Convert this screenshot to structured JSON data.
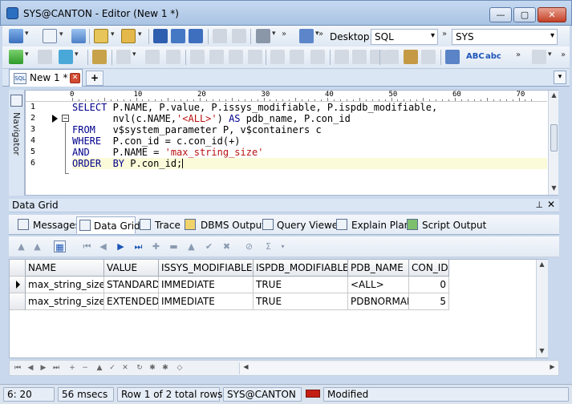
{
  "window": {
    "title": "SYS@CANTON - Editor (New 1 *)",
    "min_label": "—",
    "max_label": "▢",
    "close_label": "✕"
  },
  "toolbar": {
    "desktop_label": "Desktop:",
    "desktop_value": "SQL",
    "session_value": "SYS",
    "abc_upper": "ABC",
    "abc_lower": "abc"
  },
  "tabs": {
    "doc_tab_label": "New 1 *",
    "sql_icon_text": "SQL",
    "add_label": "+",
    "list_label": "▾"
  },
  "navigator": {
    "label": "Navigator"
  },
  "editor": {
    "ruler": [
      "0",
      "10",
      "20",
      "30",
      "40",
      "50",
      "60",
      "70"
    ],
    "line_numbers": [
      "1",
      "2",
      "3",
      "4",
      "5",
      "6"
    ],
    "lines": [
      [
        {
          "t": "SELECT",
          "k": "kw"
        },
        {
          "t": " P.NAME, P.value, P.issys_modifiable, P.ispdb_modifiable,",
          "k": ""
        }
      ],
      [
        {
          "t": "       nvl(c.NAME,",
          "k": ""
        },
        {
          "t": "'<ALL>'",
          "k": "str"
        },
        {
          "t": ") ",
          "k": ""
        },
        {
          "t": "AS",
          "k": "kw"
        },
        {
          "t": " pdb_name, P.con_id",
          "k": ""
        }
      ],
      [
        {
          "t": "FROM",
          "k": "kw"
        },
        {
          "t": "   v$system_parameter P, v$containers c",
          "k": ""
        }
      ],
      [
        {
          "t": "WHERE",
          "k": "kw"
        },
        {
          "t": "  P.con_id = c.con_id(+)",
          "k": ""
        }
      ],
      [
        {
          "t": "AND",
          "k": "kw"
        },
        {
          "t": "    P.NAME = ",
          "k": ""
        },
        {
          "t": "'max_string_size'",
          "k": "str"
        }
      ],
      [
        {
          "t": "ORDER",
          "k": "kw"
        },
        {
          "t": "  ",
          "k": ""
        },
        {
          "t": "BY",
          "k": "kw"
        },
        {
          "t": " P.con_id;",
          "k": ""
        }
      ]
    ]
  },
  "panel": {
    "title": "Data Grid",
    "pin_label": "⊥",
    "close_label": "✕"
  },
  "result_tabs": [
    "Messages",
    "Data Grid",
    "Trace",
    "DBMS Output",
    "Query Viewer",
    "Explain Plan",
    "Script Output"
  ],
  "grid": {
    "columns": [
      "NAME",
      "VALUE",
      "ISSYS_MODIFIABLE",
      "ISPDB_MODIFIABLE",
      "PDB_NAME",
      "CON_ID"
    ],
    "rows": [
      [
        "max_string_size",
        "STANDARD",
        "IMMEDIATE",
        "TRUE",
        "<ALL>",
        "0"
      ],
      [
        "max_string_size",
        "EXTENDED",
        "IMMEDIATE",
        "TRUE",
        "PDBNORMAL",
        "5"
      ]
    ]
  },
  "status": {
    "position": "6:  20",
    "elapsed": "56 msecs",
    "rows": "Row 1 of 2 total rows",
    "connection": "SYS@CANTON",
    "state": "Modified"
  }
}
